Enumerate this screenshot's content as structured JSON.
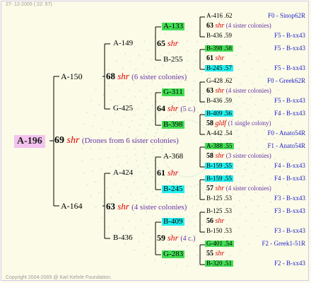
{
  "header": "27- 12-2005 ( 22: 57)",
  "footer": "Copyright 2004-2005 @ Karl Kehrle Foundation.",
  "root": {
    "label": "A-196",
    "num": "69",
    "shr": "shr",
    "note": "(Drones from 6 sister colonies)"
  },
  "gen1": [
    {
      "label": "A-150"
    },
    {
      "label": "A-164"
    }
  ],
  "gen1_mid": [
    {
      "num": "68",
      "shr": "shr",
      "note": "(6 sister colonies)"
    },
    {
      "num": "63",
      "shr": "shr",
      "note": "(4 sister colonies)"
    }
  ],
  "gen2": [
    {
      "label": "A-149"
    },
    {
      "label": "G-425"
    },
    {
      "label": "A-424"
    },
    {
      "label": "B-436"
    }
  ],
  "gen2_mid": [
    {
      "num": "65",
      "shr": "shr",
      "note": ""
    },
    {
      "num": "64",
      "shr": "shr",
      "note": "(5 c.)"
    },
    {
      "num": "61",
      "shr": "shr",
      "note": ""
    },
    {
      "num": "59",
      "shr": "shr",
      "note": "(4 c.)"
    }
  ],
  "gen3": [
    {
      "label": "A-133"
    },
    {
      "label": "B-255"
    },
    {
      "label": "G-311"
    },
    {
      "label": "B-398"
    },
    {
      "label": "A-368"
    },
    {
      "label": "B-245"
    },
    {
      "label": "B-409"
    },
    {
      "label": "G-283"
    }
  ],
  "gen4": [
    {
      "top": "A-416 .62",
      "mid": "63",
      "shr": "shr",
      "note": "(4 sister colonies)",
      "bot": "B-436 .59"
    },
    {
      "top": "B-398 .58",
      "mid": "61",
      "shr": "shr",
      "note": "",
      "bot": "B-245 .57"
    },
    {
      "top": "G-428 .62",
      "mid": "63",
      "shr": "shr",
      "note": "(4 sister colonies)",
      "bot": "B-436 .59"
    },
    {
      "top": "B-409 .56",
      "mid": "58",
      "shr": "gldf",
      "note": "(1 single colony)",
      "bot": "A-442 .54"
    },
    {
      "top": "A-388 .55",
      "mid": "58",
      "shr": "shr",
      "note": "(3 sister colonies)",
      "bot": "B-159 .55"
    },
    {
      "top": "B-159 .55",
      "mid": "57",
      "shr": "shr",
      "note": "(4 sister colonies)",
      "bot": "B-125 .53"
    },
    {
      "top": "B-125 .53",
      "mid": "56",
      "shr": "shr",
      "note": "",
      "bot": "B-150 .53"
    },
    {
      "top": "G-401 .54",
      "mid": "55",
      "shr": "shr",
      "note": "",
      "bot": "B-320 .51"
    }
  ],
  "gen4_origin": [
    "F0 - Sinop62R",
    "F5 - B-xx43",
    "F5 - B-xx43",
    "F5 - B-xx43",
    "F0 - Greek62R",
    "F5 - B-xx43",
    "F4 - B-xx43",
    "F0 - Anato54R",
    "F1 - Anato54R",
    "F4 - B-xx43",
    "F4 - B-xx43",
    "F3 - B-xx43",
    "F3 - B-xx43",
    "F3 - B-xx43",
    "F2 - Greek1-51R",
    "F2 - B-xx43"
  ],
  "colors": {
    "green": "#44dd55",
    "cyan": "#22eeee",
    "root_bg": "#f4c2f0",
    "shr": "#e00000",
    "note": "#6a33aa",
    "origin": "#2222cc"
  }
}
